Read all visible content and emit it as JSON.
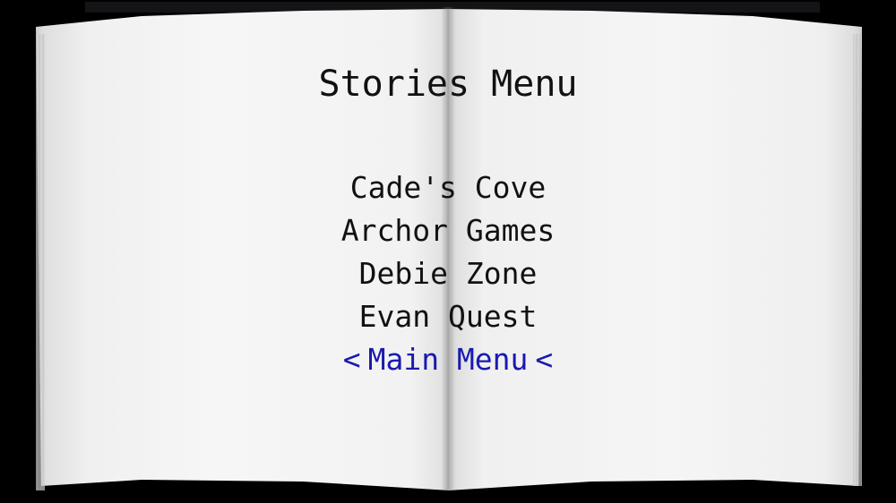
{
  "menu": {
    "title": "Stories Menu",
    "items": [
      {
        "label": "Cade's Cove"
      },
      {
        "label": "Archor Games"
      },
      {
        "label": "Debie Zone"
      },
      {
        "label": "Evan Quest"
      },
      {
        "label": "Main Menu"
      }
    ],
    "selected_index": 4,
    "cursor_left": "<",
    "cursor_right": "<"
  },
  "colors": {
    "background": "#000000",
    "page": "#f2f2f2",
    "text": "#111111",
    "selected_text": "#1a1ab0"
  }
}
